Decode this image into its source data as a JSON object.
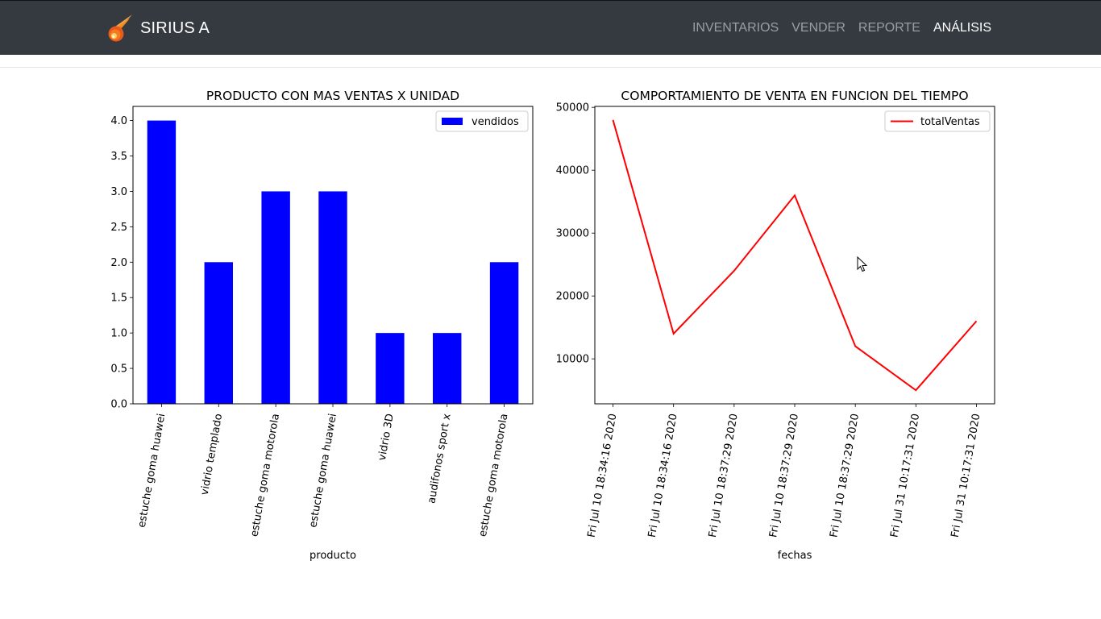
{
  "navbar": {
    "brand": "SIRIUS A",
    "links": [
      "INVENTARIOS",
      "VENDER",
      "REPORTE",
      "ANÁLISIS"
    ],
    "active_link": "ANÁLISIS",
    "icons": {
      "brand": "comet-icon",
      "cursor": "mouse-pointer-icon"
    },
    "colors": {
      "background": "#343a40",
      "active": "#ffffff",
      "inactive": "#9a9da0"
    }
  },
  "chart_data": [
    {
      "type": "bar",
      "title": "PRODUCTO CON MAS VENTAS X UNIDAD",
      "xlabel": "producto",
      "ylabel": "",
      "categories": [
        "estuche goma huawei",
        "vidrio templado",
        "estuche goma motorola",
        "estuche goma huawei",
        "vidrio 3D",
        "audifonos sport x",
        "estuche goma motorola"
      ],
      "series": [
        {
          "name": "vendidos",
          "values": [
            4,
            2,
            3,
            3,
            1,
            1,
            2
          ],
          "color": "#0000ff"
        }
      ],
      "ylim": [
        0,
        4.2
      ],
      "yticks": [
        "0.0",
        "0.5",
        "1.0",
        "1.5",
        "2.0",
        "2.5",
        "3.0",
        "3.5",
        "4.0"
      ],
      "legend": "top-right",
      "grid": false
    },
    {
      "type": "line",
      "title": "COMPORTAMIENTO DE VENTA EN FUNCION DEL TIEMPO",
      "xlabel": "fechas",
      "ylabel": "",
      "x": [
        "Fri Jul 10 18:34:16 2020",
        "Fri Jul 10 18:34:16 2020",
        "Fri Jul 10 18:37:29 2020",
        "Fri Jul 10 18:37:29 2020",
        "Fri Jul 10 18:37:29 2020",
        "Fri Jul 31 10:17:31 2020",
        "Fri Jul 31 10:17:31 2020"
      ],
      "series": [
        {
          "name": "totalVentas",
          "values": [
            48000,
            14000,
            24000,
            36000,
            12000,
            5000,
            16000
          ],
          "color": "#ff0000"
        }
      ],
      "ylim": [
        2850,
        50150
      ],
      "yticks": [
        "10000",
        "20000",
        "30000",
        "40000",
        "50000"
      ],
      "legend": "top-right",
      "grid": false
    }
  ]
}
